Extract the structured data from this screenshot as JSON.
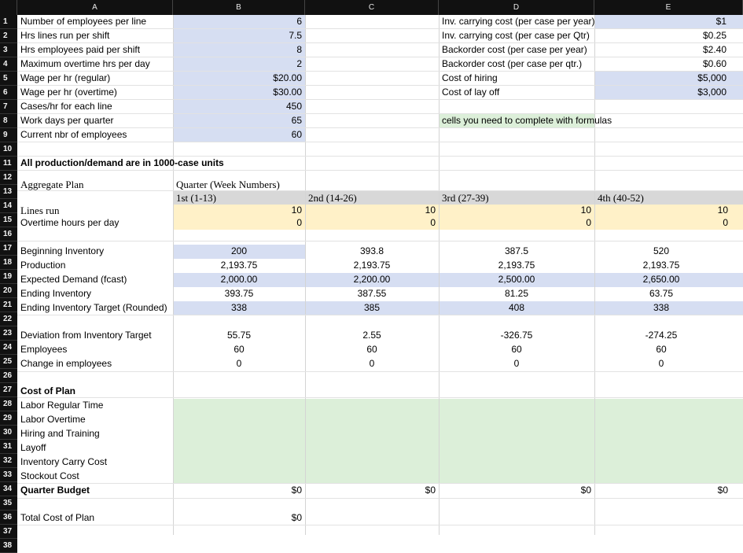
{
  "columns": [
    "A",
    "B",
    "C",
    "D",
    "E"
  ],
  "rows": [
    "1",
    "2",
    "3",
    "4",
    "5",
    "6",
    "7",
    "8",
    "9",
    "10",
    "11",
    "12",
    "13",
    "14",
    "15",
    "16",
    "17",
    "18",
    "19",
    "20",
    "21",
    "22",
    "23",
    "24",
    "25",
    "26",
    "27",
    "28",
    "29",
    "30",
    "31",
    "32",
    "33",
    "34",
    "35",
    "36",
    "37",
    "38"
  ],
  "params": [
    {
      "label": "Number of employees per line",
      "value": "6"
    },
    {
      "label": "Hrs lines run per shift",
      "value": "7.5"
    },
    {
      "label": "Hrs employees paid per shift",
      "value": "8"
    },
    {
      "label": "Maximum overtime hrs  per day",
      "value": "2"
    },
    {
      "label": "Wage per hr (regular)",
      "value": "$20.00"
    },
    {
      "label": "Wage per hr (overtime)",
      "value": "$30.00"
    },
    {
      "label": "Cases/hr for each line",
      "value": "450"
    },
    {
      "label": "Work days per quarter",
      "value": "65"
    },
    {
      "label": "Current nbr of employees",
      "value": "60"
    }
  ],
  "costs": [
    {
      "label": "Inv. carrying cost (per case per year)",
      "value": "$1"
    },
    {
      "label": "Inv. carrying cost (per case per Qtr)",
      "value": "$0.25"
    },
    {
      "label": "Backorder cost (per case per year)",
      "value": "$2.40"
    },
    {
      "label": "Backorder cost (per case per qtr.)",
      "value": "$0.60"
    },
    {
      "label": "Cost of hiring",
      "value": "$5,000"
    },
    {
      "label": "Cost of lay off",
      "value": "$3,000"
    }
  ],
  "note": "cells you need to complete with formulas",
  "units_note": "All production/demand are in 1000-case units",
  "plan": {
    "title": "Aggregate Plan",
    "quarter_header": "Quarter (Week Numbers)",
    "quarters": [
      "1st (1-13)",
      "2nd (14-26)",
      "3rd (27-39)",
      "4th (40-52)"
    ],
    "lines_run_label": "Lines run",
    "overtime_label": "Overtime hours per day",
    "lines_run": [
      "10",
      "10",
      "10",
      "10"
    ],
    "overtime": [
      "0",
      "0",
      "0",
      "0"
    ]
  },
  "inventory_rows": [
    {
      "label": "Beginning Inventory",
      "values": [
        "200",
        "393.8",
        "387.5",
        "520"
      ]
    },
    {
      "label": "Production",
      "values": [
        "2,193.75",
        "2,193.75",
        "2,193.75",
        "2,193.75"
      ]
    },
    {
      "label": "Expected Demand (fcast)",
      "values": [
        "2,000.00",
        "2,200.00",
        "2,500.00",
        "2,650.00"
      ]
    },
    {
      "label": "Ending Inventory",
      "values": [
        "393.75",
        "387.55",
        "81.25",
        "63.75"
      ]
    },
    {
      "label": "Ending Inventory Target (Rounded)",
      "values": [
        "338",
        "385",
        "408",
        "338"
      ]
    }
  ],
  "employee_rows": [
    {
      "label": "Deviation from Inventory Target",
      "values": [
        "55.75",
        "2.55",
        "-326.75",
        "-274.25"
      ]
    },
    {
      "label": "Employees",
      "values": [
        "60",
        "60",
        "60",
        "60"
      ]
    },
    {
      "label": "Change in employees",
      "values": [
        "0",
        "0",
        "0",
        "0"
      ]
    }
  ],
  "cost_plan": {
    "title": "Cost of Plan",
    "items": [
      "Labor Regular Time",
      "Labor Overtime",
      "Hiring and Training",
      "Layoff",
      "Inventory Carry Cost",
      "Stockout Cost"
    ],
    "budget_label": "Quarter Budget",
    "budget": [
      "$0",
      "$0",
      "$0",
      "$0"
    ],
    "total_label": "Total Cost of Plan",
    "total": "$0"
  },
  "colors": {
    "input_blue": "#d6def2",
    "decision_yellow": "#fff1c8",
    "formula_green": "#dcefd9",
    "header_grey": "#d8d8d8",
    "header_dark": "#111111"
  }
}
